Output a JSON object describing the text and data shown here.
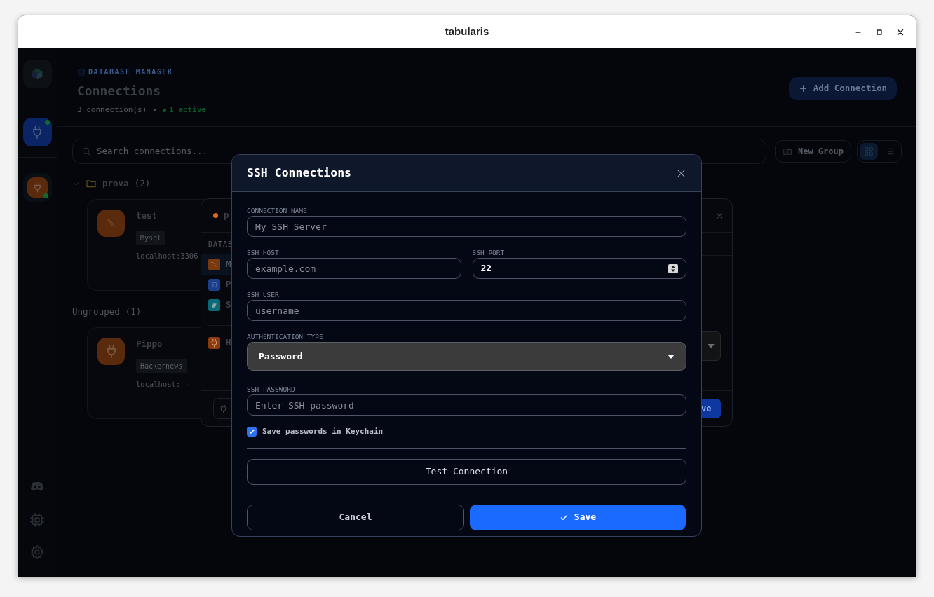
{
  "window": {
    "title": "tabularis"
  },
  "sidebar": {
    "items": [
      {
        "kind": "logo",
        "selected": false
      },
      {
        "kind": "connections",
        "selected": true,
        "connected": true
      },
      {
        "kind": "connection",
        "selected": false,
        "connected": true
      }
    ],
    "bottom_items": [
      {
        "kind": "discord"
      },
      {
        "kind": "cpu"
      },
      {
        "kind": "settings"
      }
    ]
  },
  "header": {
    "eyebrow": "DATABASE MANAGER",
    "title": "Connections",
    "count": "3 connection(s)",
    "separator": "•",
    "active": "1 active",
    "add_button": "Add Connection"
  },
  "toolbar": {
    "search": {
      "placeholder": "Search connections..."
    },
    "new_group": "New Group",
    "views": [
      {
        "kind": "grid",
        "selected": true
      },
      {
        "kind": "list",
        "selected": false
      }
    ]
  },
  "groups": [
    {
      "kind": "folder",
      "name": "prova",
      "count": "(2)",
      "expanded": true,
      "connections": [
        {
          "name": "test",
          "kind": "mysql",
          "tag": "Mysql",
          "host": "localhost:3306"
        }
      ]
    },
    {
      "kind": "plain",
      "name": "Ungrouped",
      "count": "(1)",
      "connections": [
        {
          "name": "Pippo",
          "kind": "plug",
          "tag": "Hackernews",
          "host": "localhost: ·"
        }
      ]
    }
  ],
  "connection_dialog": {
    "title": "p",
    "color": "#e2661a",
    "section": "DATAB",
    "items": [
      {
        "label": "M",
        "kind": "mysql",
        "selected": true
      },
      {
        "label": "P",
        "kind": "postgres",
        "selected": false
      },
      {
        "label": "S",
        "kind": "sqlite",
        "selected": false
      },
      {
        "label": "H",
        "kind": "plug",
        "selected": false
      }
    ],
    "save_button": "ve"
  },
  "ssh_modal": {
    "title": "SSH Connections",
    "fields": [
      {
        "kind": "text",
        "label": "CONNECTION NAME",
        "placeholder": "My SSH Server"
      },
      {
        "kind": "pair",
        "items": [
          {
            "kind": "text",
            "label": "SSH HOST",
            "placeholder": "example.com"
          },
          {
            "kind": "number",
            "label": "SSH PORT",
            "value": "22"
          }
        ]
      },
      {
        "kind": "text",
        "label": "SSH USER",
        "placeholder": "username"
      },
      {
        "kind": "select",
        "label": "AUTHENTICATION TYPE",
        "value": "Password"
      },
      {
        "kind": "password",
        "label": "SSH PASSWORD",
        "placeholder": "Enter SSH password"
      }
    ],
    "save_to_keychain": {
      "label": "Save passwords in Keychain",
      "checked": true
    },
    "test_button": "Test Connection",
    "cancel_button": "Cancel",
    "save_button": "Save"
  }
}
